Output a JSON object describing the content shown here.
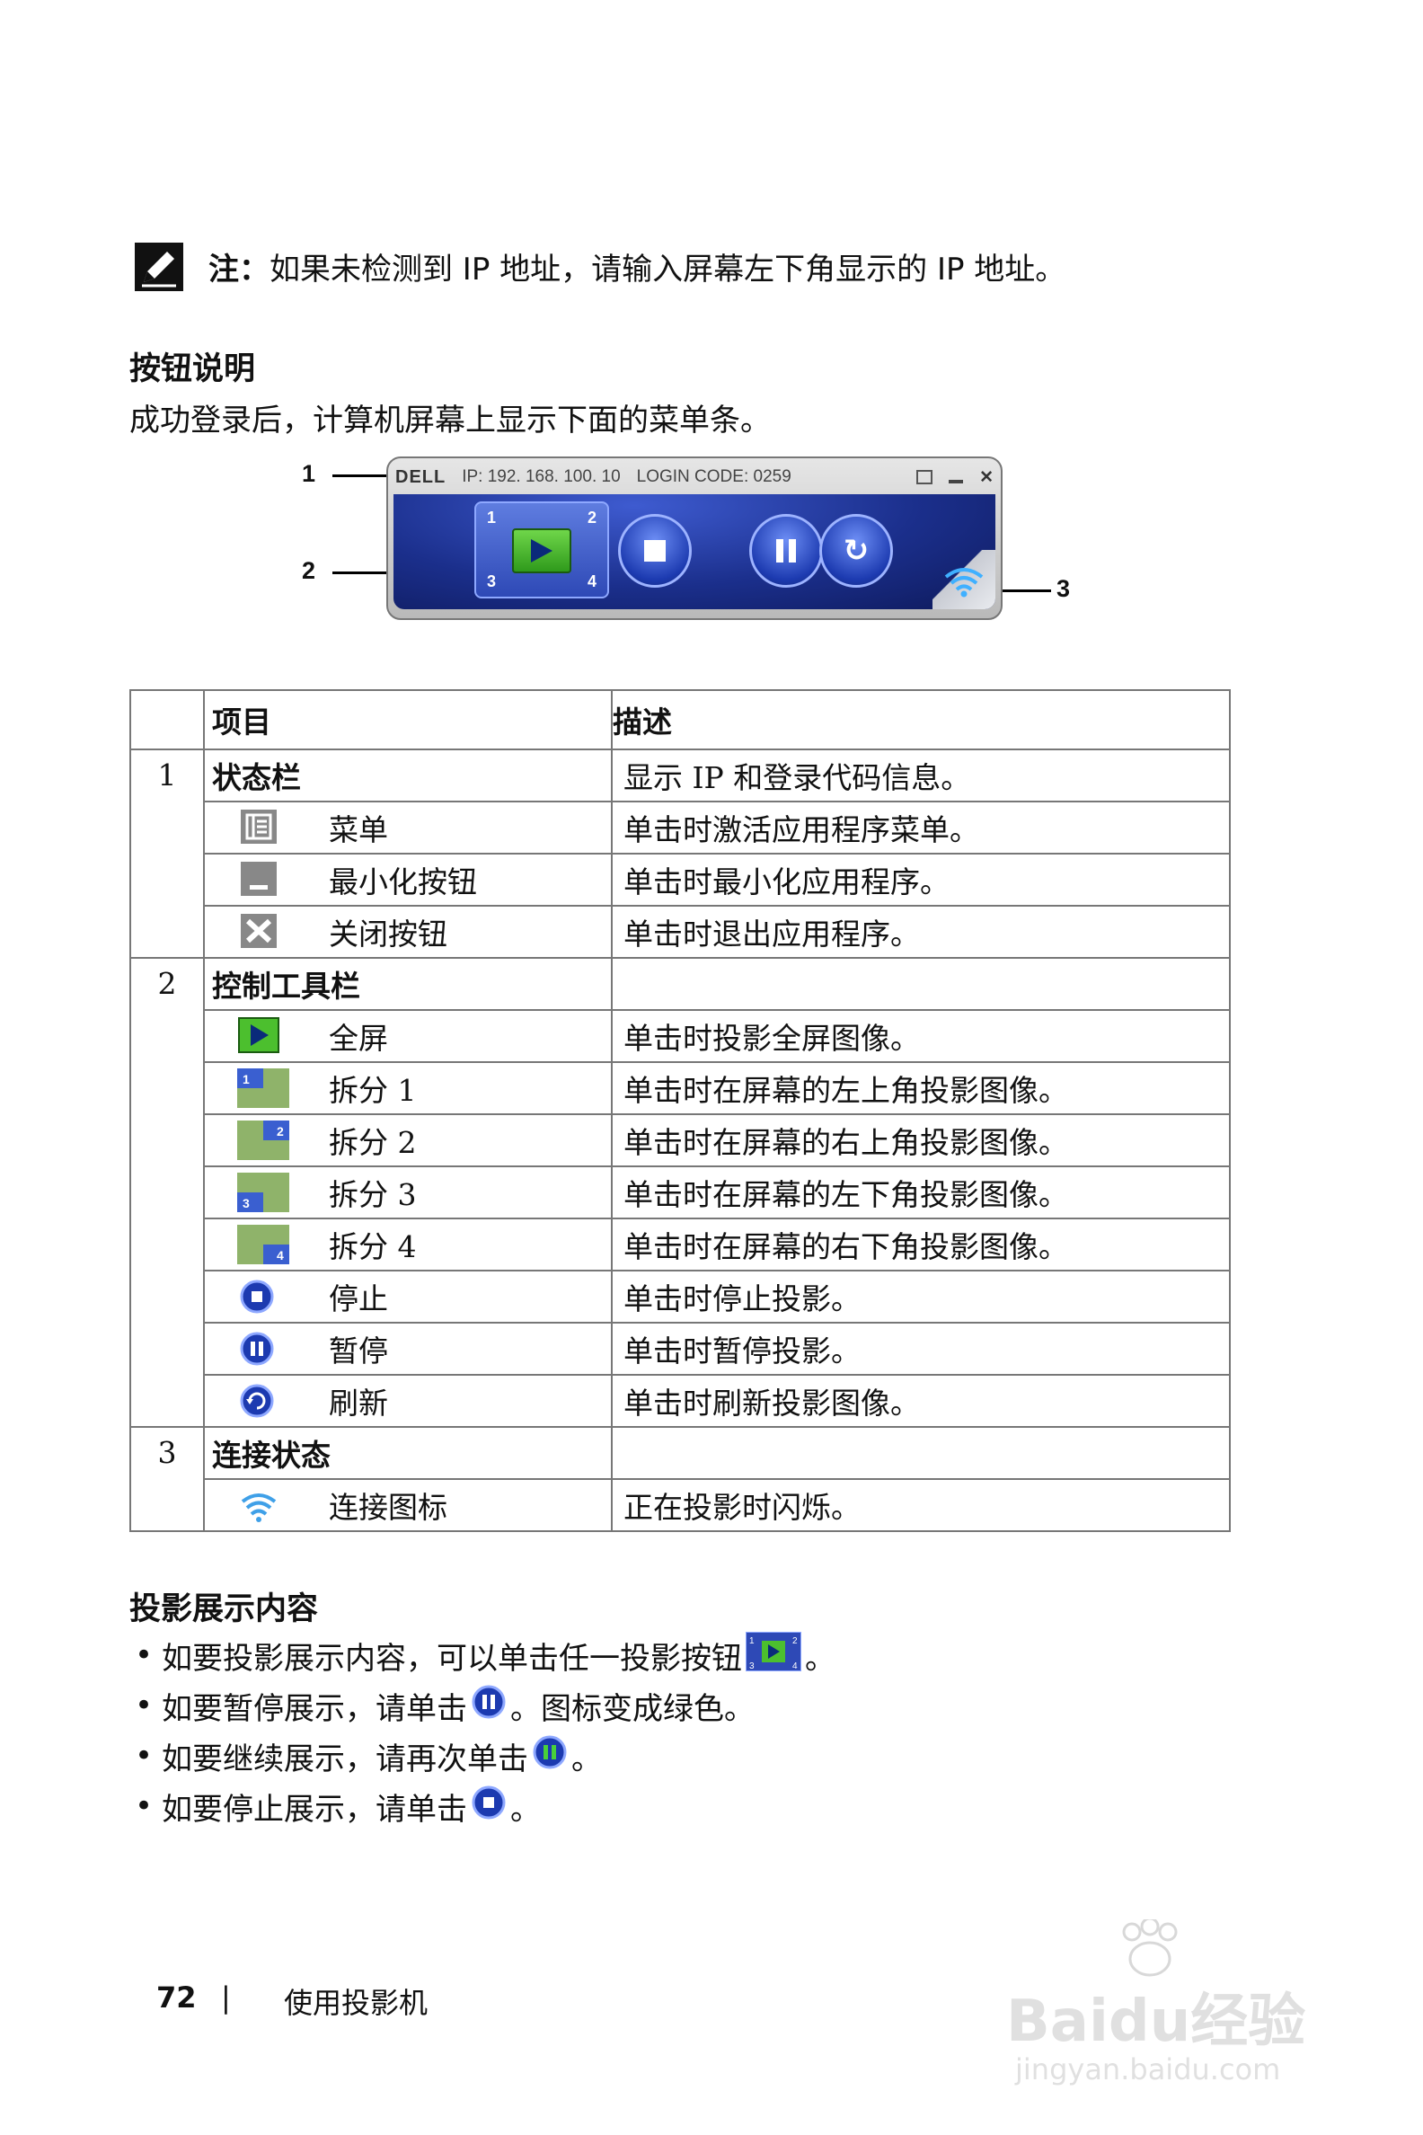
{
  "note": {
    "label": "注：",
    "text": "如果未检测到 IP 地址，请输入屏幕左下角显示的 IP 地址。"
  },
  "section1": {
    "title": "按钮说明",
    "intro": "成功登录后，计算机屏幕上显示下面的菜单条。"
  },
  "toolbar": {
    "logo": "DELL",
    "ip": "IP: 192. 168. 100. 10",
    "login_code": "LOGIN CODE: 0259",
    "quad_labels": [
      "1",
      "2",
      "3",
      "4"
    ],
    "callouts": [
      "1",
      "2",
      "3"
    ]
  },
  "table": {
    "header_item": "项目",
    "header_desc": "描述",
    "groups": [
      {
        "num": "1",
        "title": "状态栏",
        "desc": "显示 IP 和登录代码信息。",
        "rows": [
          {
            "icon": "menu-icon",
            "name": "菜单",
            "desc": "单击时激活应用程序菜单。"
          },
          {
            "icon": "minimize-icon",
            "name": "最小化按钮",
            "desc": "单击时最小化应用程序。"
          },
          {
            "icon": "close-icon",
            "name": "关闭按钮",
            "desc": "单击时退出应用程序。"
          }
        ]
      },
      {
        "num": "2",
        "title": "控制工具栏",
        "desc": "",
        "rows": [
          {
            "icon": "play-icon",
            "name": "全屏",
            "desc": "单击时投影全屏图像。"
          },
          {
            "icon": "split1-icon",
            "name": "拆分 1",
            "desc": "单击时在屏幕的左上角投影图像。"
          },
          {
            "icon": "split2-icon",
            "name": "拆分 2",
            "desc": "单击时在屏幕的右上角投影图像。"
          },
          {
            "icon": "split3-icon",
            "name": "拆分 3",
            "desc": "单击时在屏幕的左下角投影图像。"
          },
          {
            "icon": "split4-icon",
            "name": "拆分 4",
            "desc": "单击时在屏幕的右下角投影图像。"
          },
          {
            "icon": "stop-icon",
            "name": "停止",
            "desc": "单击时停止投影。"
          },
          {
            "icon": "pause-icon",
            "name": "暂停",
            "desc": "单击时暂停投影。"
          },
          {
            "icon": "refresh-icon",
            "name": "刷新",
            "desc": "单击时刷新投影图像。"
          }
        ]
      },
      {
        "num": "3",
        "title": "连接状态",
        "desc": "",
        "rows": [
          {
            "icon": "wifi-icon",
            "name": "连接图标",
            "desc": "正在投影时闪烁。"
          }
        ]
      }
    ]
  },
  "section2": {
    "title": "投影展示内容",
    "bullets": [
      {
        "pre": "如要投影展示内容，可以单击任一投影按钮",
        "post": "。"
      },
      {
        "pre": "如要暂停展示，请单击",
        "post": "。图标变成绿色。"
      },
      {
        "pre": "如要继续展示，请再次单击",
        "post": "。"
      },
      {
        "pre": "如要停止展示，请单击",
        "post": "。"
      }
    ]
  },
  "footer": {
    "page_number": "72",
    "separator": "|",
    "chapter": "使用投影机"
  },
  "watermark": {
    "brand": "Baidu经验",
    "url": "jingyan.baidu.com"
  }
}
